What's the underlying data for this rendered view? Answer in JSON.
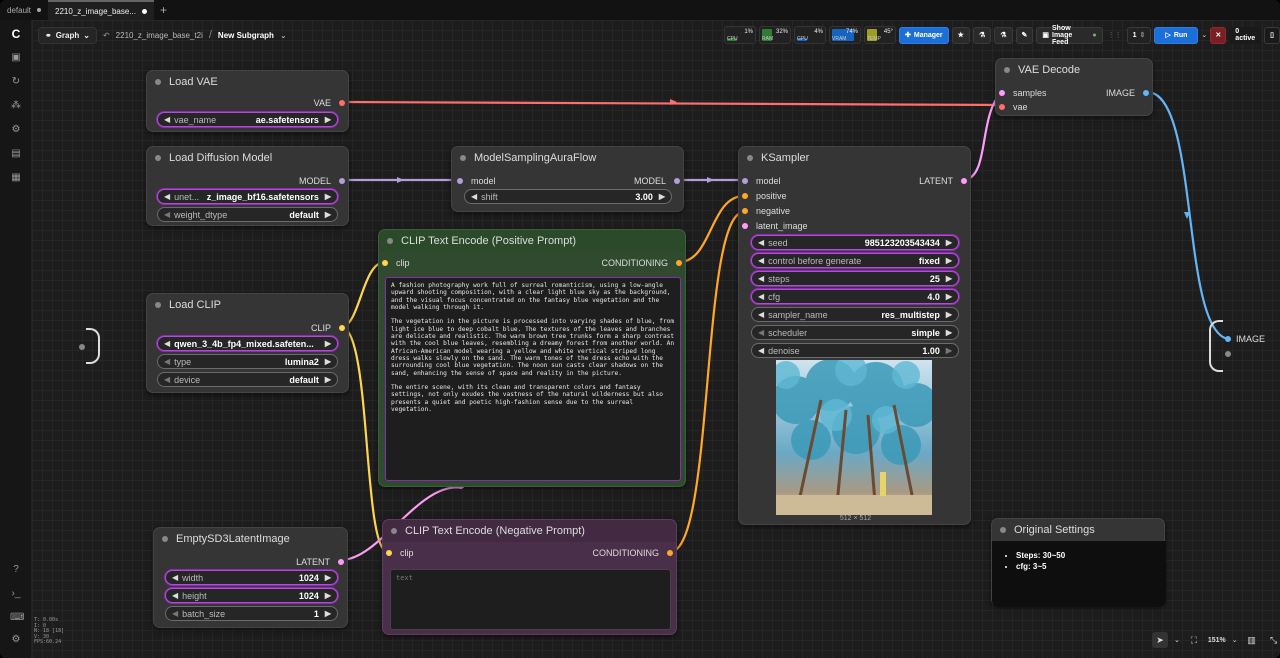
{
  "tabs": [
    {
      "label": "default"
    },
    {
      "label": "2210_z_image_base..."
    }
  ],
  "toolbar": {
    "graph_label": "Graph",
    "breadcrumb_workflow": "2210_z_image_base_t2i",
    "breadcrumb_subgraph": "New Subgraph",
    "meters": [
      {
        "name": "CPU",
        "value": "1%",
        "color": "#2e7d32"
      },
      {
        "name": "RAM",
        "value": "32%",
        "color": "#2e7d32"
      },
      {
        "name": "GPU",
        "value": "4%",
        "color": "#1565c0"
      },
      {
        "name": "VRAM",
        "value": "74%",
        "color": "#1565c0"
      },
      {
        "name": "TEMP",
        "value": "45°",
        "color": "#9e9d24"
      }
    ],
    "manager_label": "Manager",
    "image_feed_label": "Show Image Feed",
    "queue_count": "1",
    "run_label": "Run",
    "active_label": "0 active"
  },
  "nodes": {
    "load_vae": {
      "title": "Load VAE",
      "output": "VAE",
      "widgets": [
        {
          "name": "vae_name",
          "value": "ae.safetensors"
        }
      ]
    },
    "load_diffusion": {
      "title": "Load Diffusion Model",
      "output": "MODEL",
      "widgets": [
        {
          "name": "unet...",
          "value": "z_image_bf16.safetensors"
        },
        {
          "name": "weight_dtype",
          "value": "default"
        }
      ]
    },
    "model_sampling": {
      "title": "ModelSamplingAuraFlow",
      "input": "model",
      "output": "MODEL",
      "widgets": [
        {
          "name": "shift",
          "value": "3.00"
        }
      ]
    },
    "load_clip": {
      "title": "Load CLIP",
      "output": "CLIP",
      "widgets": [
        {
          "name": "",
          "value": "qwen_3_4b_fp4_mixed.safeten..."
        },
        {
          "name": "type",
          "value": "lumina2"
        },
        {
          "name": "device",
          "value": "default"
        }
      ]
    },
    "clip_pos": {
      "title": "CLIP Text Encode (Positive Prompt)",
      "input": "clip",
      "output": "CONDITIONING",
      "text": "A fashion photography work full of surreal romanticism, using a low-angle upward shooting composition, with a clear light blue sky as the background, and the visual focus concentrated on the fantasy blue vegetation and the model walking through it.\n\nThe vegetation in the picture is processed into varying shades of blue, from light ice blue to deep cobalt blue. The textures of the leaves and branches are delicate and realistic. The warm brown tree trunks form a sharp contrast with the cool blue leaves, resembling a dreamy forest from another world. An African-American model wearing a yellow and white vertical striped long dress walks slowly on the sand. The warm tones of the dress echo with the surrounding cool blue vegetation. The noon sun casts clear shadows on the sand, enhancing the sense of space and reality in the picture.\n\nThe entire scene, with its clean and transparent colors and fantasy settings, not only exudes the vastness of the natural wilderness but also presents a quiet and poetic high-fashion sense due to the surreal vegetation."
    },
    "clip_neg": {
      "title": "CLIP Text Encode (Negative Prompt)",
      "input": "clip",
      "output": "CONDITIONING",
      "placeholder": "text"
    },
    "empty_latent": {
      "title": "EmptySD3LatentImage",
      "output": "LATENT",
      "widgets": [
        {
          "name": "width",
          "value": "1024"
        },
        {
          "name": "height",
          "value": "1024"
        },
        {
          "name": "batch_size",
          "value": "1"
        }
      ]
    },
    "ksampler": {
      "title": "KSampler",
      "inputs": [
        "model",
        "positive",
        "negative",
        "latent_image"
      ],
      "output": "LATENT",
      "widgets": [
        {
          "name": "seed",
          "value": "985123203543434"
        },
        {
          "name": "control before generate",
          "value": "fixed"
        },
        {
          "name": "steps",
          "value": "25"
        },
        {
          "name": "cfg",
          "value": "4.0"
        },
        {
          "name": "sampler_name",
          "value": "res_multistep"
        },
        {
          "name": "scheduler",
          "value": "simple"
        },
        {
          "name": "denoise",
          "value": "1.00"
        }
      ],
      "preview_size": "512 × 512"
    },
    "vae_decode": {
      "title": "VAE Decode",
      "inputs": [
        "samples",
        "vae"
      ],
      "output": "IMAGE"
    },
    "original_settings": {
      "title": "Original Settings",
      "items": [
        "Steps: 30~50",
        "cfg: 3~5"
      ]
    },
    "subgraph_out": {
      "label": "IMAGE"
    }
  },
  "colors": {
    "vae": "#ff6e6e",
    "model": "#b39ddb",
    "clip": "#ffd54f",
    "conditioning": "#ffa726",
    "latent": "#ff9cf9",
    "image": "#64b5f6"
  },
  "stats": [
    "T: 0.00s",
    "I: 0",
    "N: 18 [18]",
    "V: 30",
    "FPS:60.24"
  ],
  "zoom": "151%"
}
